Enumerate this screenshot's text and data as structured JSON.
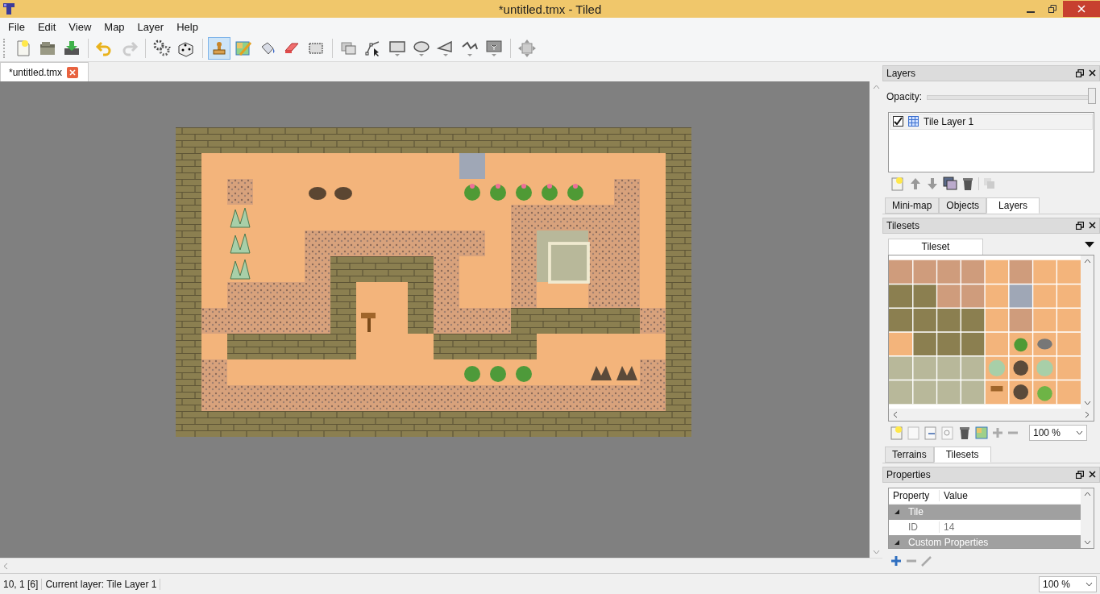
{
  "window": {
    "title": "*untitled.tmx - Tiled"
  },
  "menu": [
    "File",
    "Edit",
    "View",
    "Map",
    "Layer",
    "Help"
  ],
  "toolbar": [
    {
      "kind": "new",
      "selected": false,
      "disabled": false
    },
    {
      "kind": "open",
      "selected": false,
      "disabled": false
    },
    {
      "kind": "save",
      "selected": false,
      "disabled": false
    },
    {
      "kind": "undo",
      "selected": false,
      "disabled": false
    },
    {
      "kind": "redo",
      "selected": false,
      "disabled": true
    },
    {
      "kind": "random",
      "selected": false,
      "disabled": false
    },
    {
      "kind": "dice",
      "selected": false,
      "disabled": false
    },
    {
      "kind": "stamp",
      "selected": true,
      "disabled": false
    },
    {
      "kind": "terrain",
      "selected": false,
      "disabled": false
    },
    {
      "kind": "fill",
      "selected": false,
      "disabled": false
    },
    {
      "kind": "eraser",
      "selected": false,
      "disabled": false
    },
    {
      "kind": "select",
      "selected": false,
      "disabled": false
    },
    {
      "kind": "objselect",
      "selected": false,
      "disabled": false
    },
    {
      "kind": "editpoly",
      "selected": false,
      "disabled": false
    },
    {
      "kind": "rect",
      "selected": false,
      "disabled": false
    },
    {
      "kind": "ellipse",
      "selected": false,
      "disabled": false
    },
    {
      "kind": "polygon",
      "selected": false,
      "disabled": false
    },
    {
      "kind": "polyline",
      "selected": false,
      "disabled": false
    },
    {
      "kind": "tileobj",
      "selected": false,
      "disabled": false
    },
    {
      "kind": "move",
      "selected": false,
      "disabled": false
    }
  ],
  "document_tabs": [
    {
      "label": "*untitled.tmx",
      "selected": true
    }
  ],
  "layers_panel": {
    "title": "Layers",
    "opacity_label": "Opacity:",
    "opacity": {
      "level": 1.0
    },
    "layers": [
      {
        "name": "Tile Layer 1",
        "visible": true,
        "selected": true
      }
    ],
    "tabs": [
      {
        "label": "Mini-map",
        "selected": false
      },
      {
        "label": "Objects",
        "selected": false
      },
      {
        "label": "Layers",
        "selected": true
      }
    ]
  },
  "tilesets_panel": {
    "title": "Tilesets",
    "tabs": [
      {
        "label": "Tileset",
        "selected": true
      }
    ],
    "zoom": "100 %",
    "bottom_tabs": [
      {
        "label": "Terrains",
        "selected": false
      },
      {
        "label": "Tilesets",
        "selected": true
      }
    ]
  },
  "properties_panel": {
    "title": "Properties",
    "columns": [
      "Property",
      "Value"
    ],
    "rows": [
      {
        "kind": "group",
        "name": "Tile",
        "expanded": true
      },
      {
        "kind": "property",
        "name": "ID",
        "value": "14"
      },
      {
        "kind": "group",
        "name": "Custom Properties",
        "expanded": true
      }
    ]
  },
  "status_bar": {
    "position": "10, 1 [6]",
    "layer": "Current layer: Tile Layer 1",
    "zoom": "100 %"
  }
}
